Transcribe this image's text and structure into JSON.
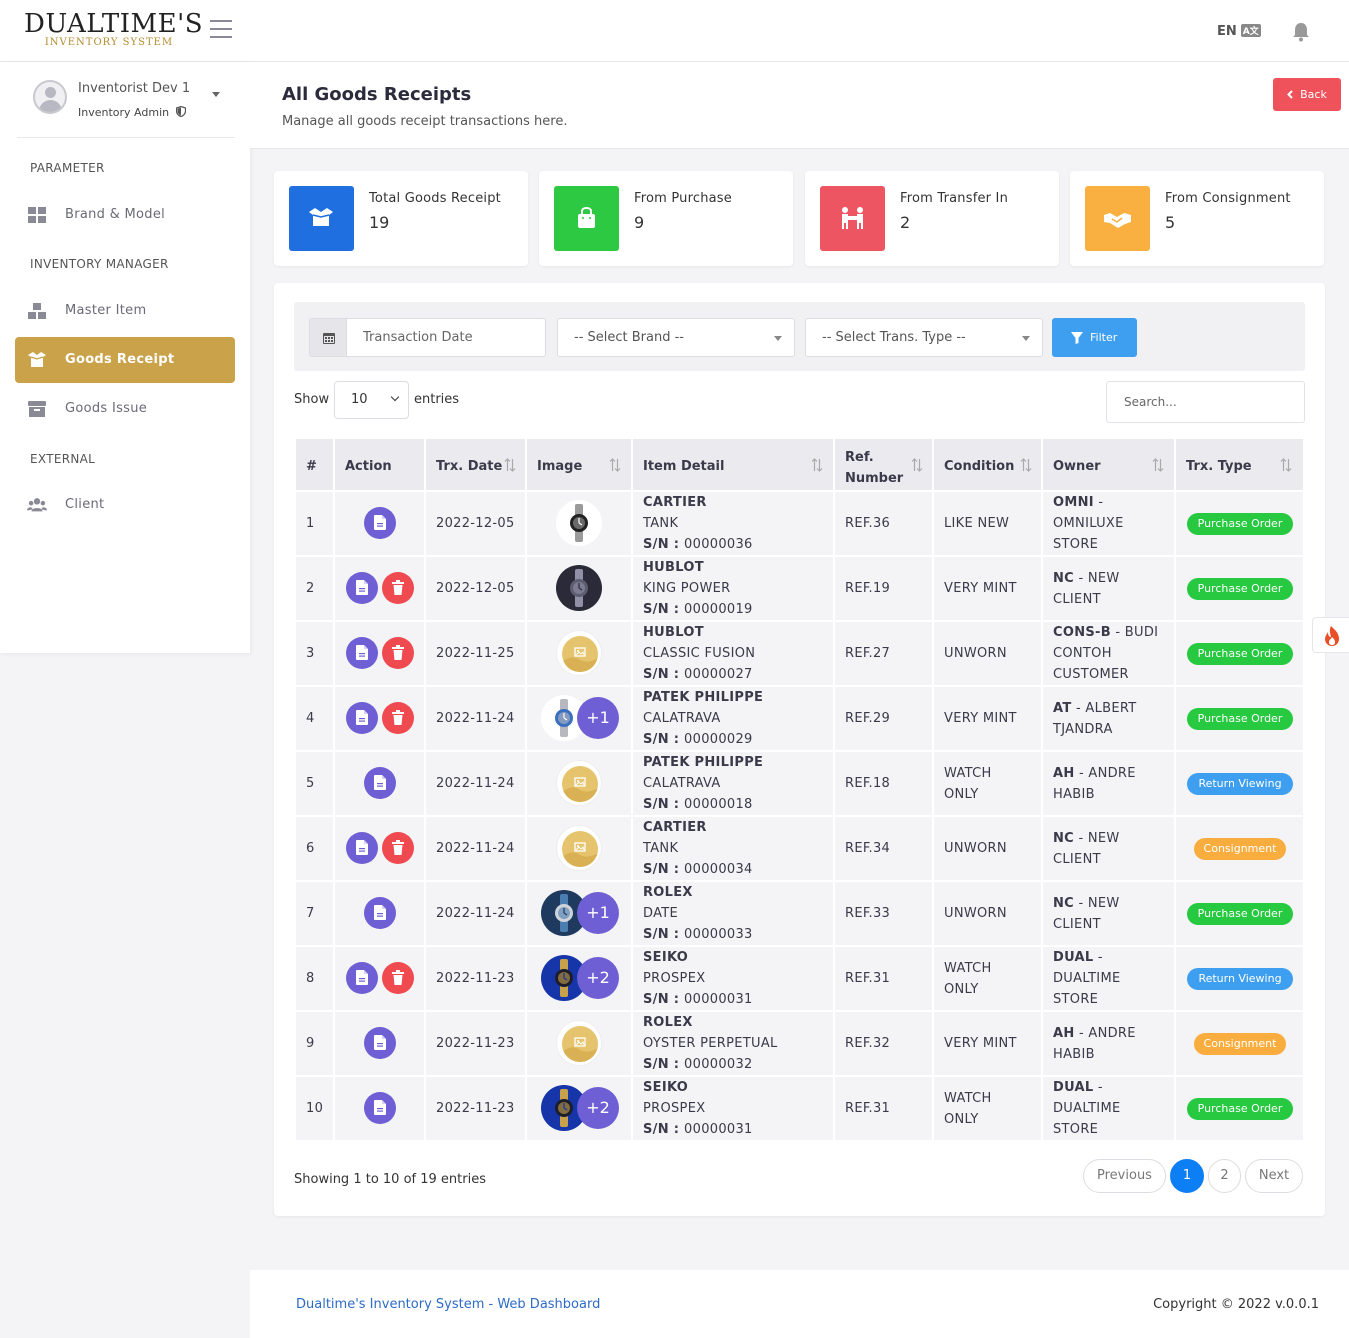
{
  "brand": {
    "name": "DUALTIME'S",
    "subtitle": "INVENTORY SYSTEM"
  },
  "header": {
    "language": "EN",
    "icons": [
      "menu-icon",
      "translate-icon",
      "bell-icon"
    ]
  },
  "user": {
    "name": "Inventorist Dev 1",
    "role": "Inventory Admin"
  },
  "sidebar": {
    "sections": [
      "PARAMETER",
      "INVENTORY MANAGER",
      "EXTERNAL"
    ],
    "items": [
      {
        "label": "Brand & Model",
        "icon": "grid-icon"
      },
      {
        "label": "Master Item",
        "icon": "boxes-icon"
      },
      {
        "label": "Goods Receipt",
        "icon": "open-box-icon",
        "active": true
      },
      {
        "label": "Goods Issue",
        "icon": "archive-icon"
      },
      {
        "label": "Client",
        "icon": "users-icon"
      }
    ]
  },
  "page": {
    "title": "All Goods Receipts",
    "subtitle": "Manage all goods receipt transactions here.",
    "back": "Back"
  },
  "stats": [
    {
      "label": "Total Goods Receipt",
      "value": "19",
      "color": "#1f6fe0",
      "icon": "box-icon"
    },
    {
      "label": "From Purchase",
      "value": "9",
      "color": "#2ec943",
      "icon": "bag-icon"
    },
    {
      "label": "From Transfer In",
      "value": "2",
      "color": "#ee5563",
      "icon": "transfer-icon"
    },
    {
      "label": "From Consignment",
      "value": "5",
      "color": "#f9b040",
      "icon": "handshake-icon"
    }
  ],
  "filters": {
    "date_placeholder": "Transaction Date",
    "brand": "-- Select Brand --",
    "type": "-- Select Trans. Type --",
    "button": "Filter"
  },
  "table_controls": {
    "show": "Show",
    "entries_value": "10",
    "entries": "entries",
    "search_placeholder": "Search..."
  },
  "columns": [
    "#",
    "Action",
    "Trx. Date",
    "Image",
    "Item Detail",
    "Ref.\nNumber",
    "Condition",
    "Owner",
    "Trx. Type"
  ],
  "rows": [
    {
      "no": "1",
      "del": false,
      "date": "2022-12-05",
      "img": "watch-tank",
      "extra": "",
      "brand": "CARTIER",
      "model": "TANK",
      "sn": "00000036",
      "ref": "REF.36",
      "cond": [
        "LIKE NEW"
      ],
      "owner_code": "OMNI",
      "owner": [
        "OMNI - ",
        "OMNILUXE",
        "STORE"
      ],
      "type": "Purchase Order"
    },
    {
      "no": "2",
      "del": true,
      "date": "2022-12-05",
      "img": "watch-dark",
      "extra": "",
      "brand": "HUBLOT",
      "model": "KING POWER",
      "sn": "00000019",
      "ref": "REF.19",
      "cond": [
        "VERY MINT"
      ],
      "owner_code": "NC",
      "owner": [
        "NC - NEW",
        "CLIENT"
      ],
      "type": "Purchase Order"
    },
    {
      "no": "3",
      "del": true,
      "date": "2022-11-25",
      "img": "placeholder",
      "extra": "",
      "brand": "HUBLOT",
      "model": "CLASSIC FUSION",
      "sn": "00000027",
      "ref": "REF.27",
      "cond": [
        "UNWORN"
      ],
      "owner_code": "CONS-B",
      "owner": [
        "CONS-B - BUDI",
        "CONTOH",
        "CUSTOMER"
      ],
      "type": "Purchase Order"
    },
    {
      "no": "4",
      "del": true,
      "date": "2022-11-24",
      "img": "watch-blue",
      "extra": "+1",
      "brand": "PATEK PHILIPPE",
      "model": "CALATRAVA",
      "sn": "00000029",
      "ref": "REF.29",
      "cond": [
        "VERY MINT"
      ],
      "owner_code": "AT",
      "owner": [
        "AT - ALBERT",
        "TJANDRA"
      ],
      "type": "Purchase Order"
    },
    {
      "no": "5",
      "del": false,
      "date": "2022-11-24",
      "img": "placeholder",
      "extra": "",
      "brand": "PATEK PHILIPPE",
      "model": "CALATRAVA",
      "sn": "00000018",
      "ref": "REF.18",
      "cond": [
        "WATCH",
        "ONLY"
      ],
      "owner_code": "AH",
      "owner": [
        "AH - ANDRE",
        "HABIB"
      ],
      "type": "Return Viewing"
    },
    {
      "no": "6",
      "del": true,
      "date": "2022-11-24",
      "img": "placeholder",
      "extra": "",
      "brand": "CARTIER",
      "model": "TANK",
      "sn": "00000034",
      "ref": "REF.34",
      "cond": [
        "UNWORN"
      ],
      "owner_code": "NC",
      "owner": [
        "NC - NEW",
        "CLIENT"
      ],
      "type": "Consignment"
    },
    {
      "no": "7",
      "del": false,
      "date": "2022-11-24",
      "img": "watch-rolex",
      "extra": "+1",
      "brand": "ROLEX",
      "model": "DATE",
      "sn": "00000033",
      "ref": "REF.33",
      "cond": [
        "UNWORN"
      ],
      "owner_code": "NC",
      "owner": [
        "NC - NEW",
        "CLIENT"
      ],
      "type": "Purchase Order"
    },
    {
      "no": "8",
      "del": true,
      "date": "2022-11-23",
      "img": "watch-seiko",
      "extra": "+2",
      "brand": "SEIKO",
      "model": "PROSPEX",
      "sn": "00000031",
      "ref": "REF.31",
      "cond": [
        "WATCH",
        "ONLY"
      ],
      "owner_code": "DUAL",
      "owner": [
        "DUAL - ",
        "DUALTIME",
        "STORE"
      ],
      "type": "Return Viewing"
    },
    {
      "no": "9",
      "del": false,
      "date": "2022-11-23",
      "img": "placeholder",
      "extra": "",
      "brand": "ROLEX",
      "model": "OYSTER PERPETUAL",
      "sn": "00000032",
      "ref": "REF.32",
      "cond": [
        "VERY MINT"
      ],
      "owner_code": "AH",
      "owner": [
        "AH - ANDRE",
        "HABIB"
      ],
      "type": "Consignment"
    },
    {
      "no": "10",
      "del": false,
      "date": "2022-11-23",
      "img": "watch-seiko",
      "extra": "+2",
      "brand": "SEIKO",
      "model": "PROSPEX",
      "sn": "00000031",
      "ref": "REF.31",
      "cond": [
        "WATCH",
        "ONLY"
      ],
      "owner_code": "DUAL",
      "owner": [
        "DUAL - ",
        "DUALTIME",
        "STORE"
      ],
      "type": "Purchase Order"
    }
  ],
  "sn_label": "S/N : ",
  "badge_colors": {
    "Purchase Order": "#26c93f",
    "Return Viewing": "#3e9ff0",
    "Consignment": "#f9ad3e"
  },
  "pagination": {
    "info": "Showing 1 to 10 of 19 entries",
    "previous": "Previous",
    "pages": [
      "1",
      "2"
    ],
    "next": "Next"
  },
  "footer": {
    "left": "Dualtime's Inventory System - Web Dashboard",
    "right": "Copyright © 2022 v.0.0.1"
  }
}
